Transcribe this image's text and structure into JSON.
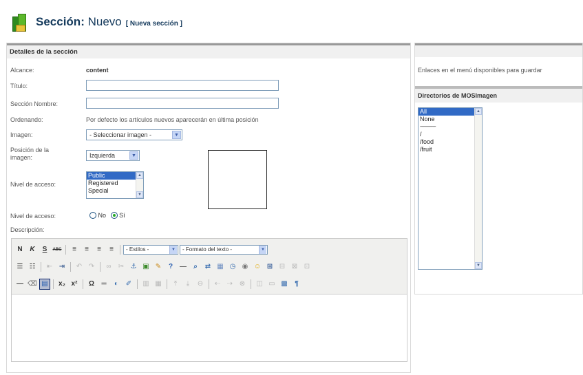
{
  "header": {
    "title_prefix": "Sección:",
    "title_word": "Nuevo",
    "subtitle": "[ Nueva sección ]"
  },
  "details": {
    "panel_title": "Detalles de la sección",
    "scope_label": "Alcance:",
    "scope_value": "content",
    "title_label": "Título:",
    "title_value": "",
    "name_label": "Sección Nombre:",
    "name_value": "",
    "ordering_label": "Ordenando:",
    "ordering_value": "Por defecto los artículos nuevos aparecerán en última posición",
    "image_label": "Imagen:",
    "image_select": "- Seleccionar imagen -",
    "image_position_label": "Posición de la imagen:",
    "image_position_select": "Izquierda",
    "access_label": "Nivel de acceso:",
    "access_options": [
      "Public",
      "Registered",
      "Special"
    ],
    "access_selected": "Public",
    "published_label": "Nivel de acceso:",
    "radio_no": "No",
    "radio_yes": "Sí",
    "radio_selected": "Sí",
    "description_label": "Descripción:"
  },
  "editor": {
    "styles_select": "- Estilos -",
    "format_select": "- Formato del texto -",
    "content": ""
  },
  "menu_panel": {
    "note": "Enlaces en el menú disponibles para guardar"
  },
  "directories": {
    "title": "Directorios de MOSImagen",
    "items": [
      "All",
      "None",
      "-----------------",
      "/",
      "/food",
      "/fruit"
    ],
    "selected": "All"
  }
}
